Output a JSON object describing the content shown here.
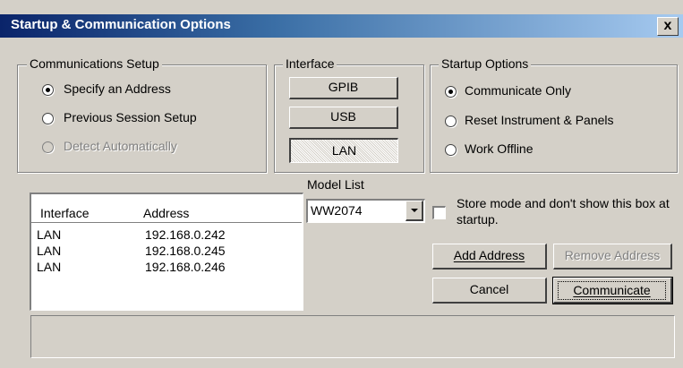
{
  "window": {
    "title": "Startup & Communication Options",
    "close_glyph": "x"
  },
  "communications_setup": {
    "title": "Communications Setup",
    "options": [
      {
        "label": "Specify an Address",
        "checked": true,
        "disabled": false
      },
      {
        "label": "Previous Session Setup",
        "checked": false,
        "disabled": false
      },
      {
        "label": "Detect Automatically",
        "checked": false,
        "disabled": true
      }
    ]
  },
  "interface": {
    "title": "Interface",
    "buttons": [
      {
        "label": "GPIB",
        "pressed": false
      },
      {
        "label": "USB",
        "pressed": false
      },
      {
        "label": "LAN",
        "pressed": true
      }
    ]
  },
  "startup_options": {
    "title": "Startup Options",
    "options": [
      {
        "label": "Communicate Only",
        "checked": true
      },
      {
        "label": "Reset Instrument & Panels",
        "checked": false
      },
      {
        "label": "Work Offline",
        "checked": false
      }
    ]
  },
  "address_list": {
    "columns": [
      "Interface",
      "Address"
    ],
    "rows": [
      [
        "LAN",
        "192.168.0.242"
      ],
      [
        "LAN",
        "192.168.0.245"
      ],
      [
        "LAN",
        "192.168.0.246"
      ]
    ]
  },
  "model_list": {
    "label": "Model List",
    "selected": "WW2074"
  },
  "store_mode": {
    "label": "Store mode and don't show this box at startup.",
    "checked": false
  },
  "buttons": {
    "add_address": "Add Address",
    "remove_address": "Remove Address",
    "cancel": "Cancel",
    "communicate": "Communicate"
  },
  "icons": {
    "close": "close-icon",
    "dropdown": "chevron-down-icon",
    "checkbox": "checkbox-icon",
    "radio": "radio-icon"
  },
  "colors": {
    "titlebar_start": "#0a246a",
    "titlebar_end": "#a6caf0",
    "dialog_face": "#d4d0c8",
    "disabled_text": "#808080"
  }
}
